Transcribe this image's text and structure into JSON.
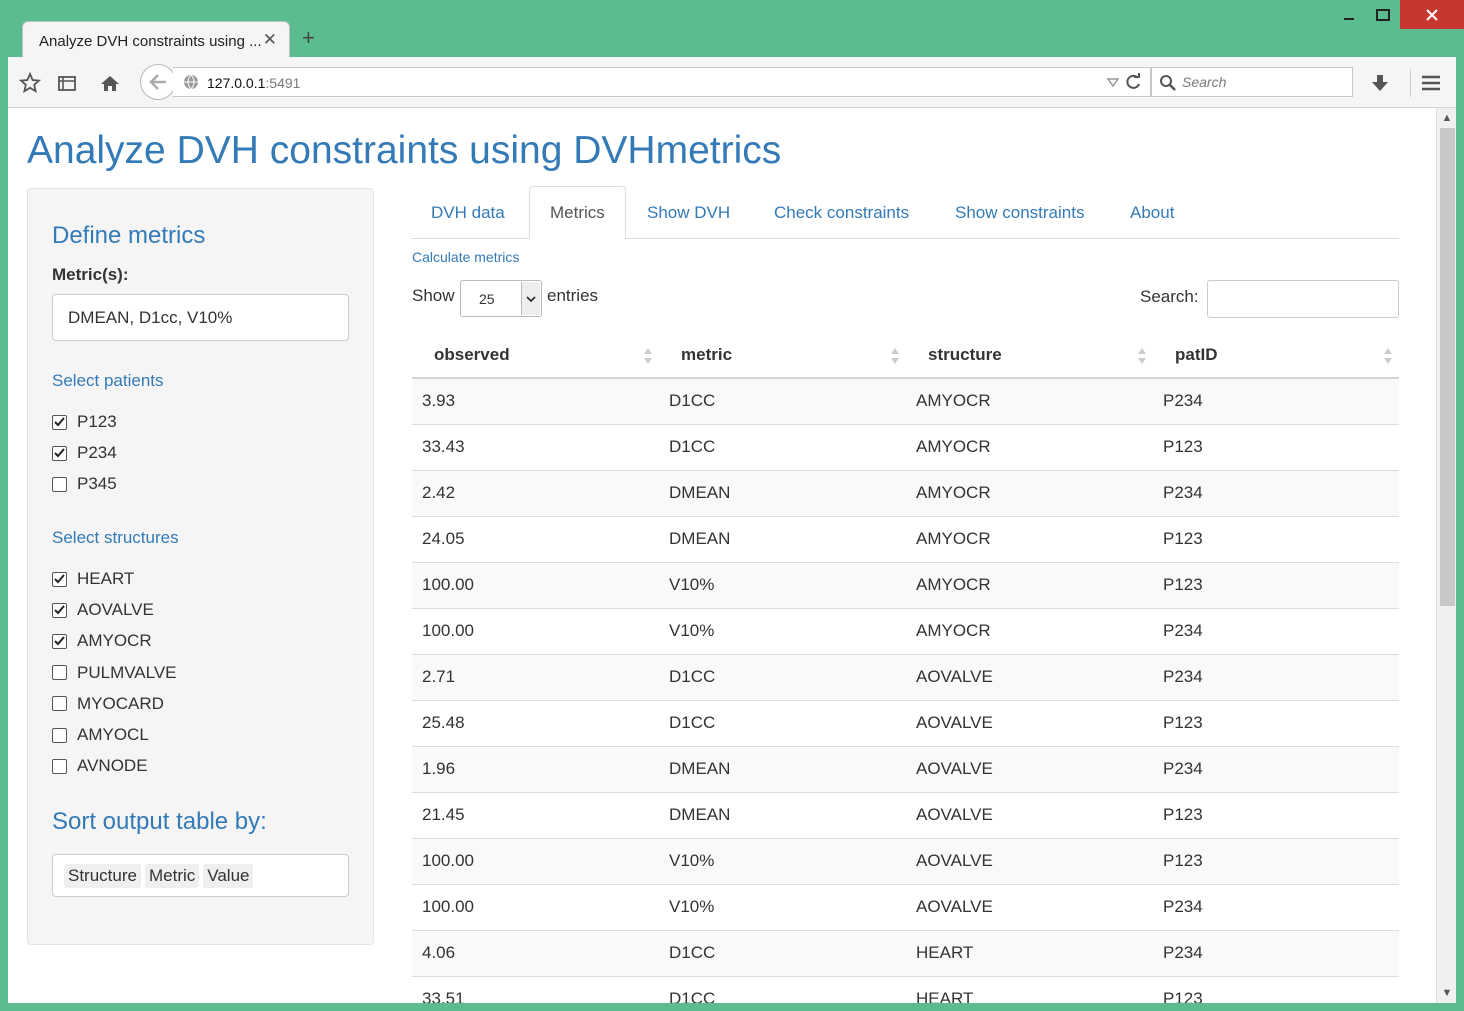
{
  "browser": {
    "tab_title": "Analyze DVH constraints using ...",
    "new_tab": "+",
    "url_host": "127.0.0.1",
    "url_port": ":5491",
    "search_placeholder": "Search"
  },
  "page": {
    "title": "Analyze DVH constraints using DVHmetrics"
  },
  "sidebar": {
    "define_heading": "Define metrics",
    "metrics_label": "Metric(s):",
    "metrics_value": "DMEAN, D1cc, V10%",
    "patients_heading": "Select patients",
    "patients": [
      {
        "label": "P123",
        "checked": true
      },
      {
        "label": "P234",
        "checked": true
      },
      {
        "label": "P345",
        "checked": false
      }
    ],
    "structures_heading": "Select structures",
    "structures": [
      {
        "label": "HEART",
        "checked": true
      },
      {
        "label": "AOVALVE",
        "checked": true
      },
      {
        "label": "AMYOCR",
        "checked": true
      },
      {
        "label": "PULMVALVE",
        "checked": false
      },
      {
        "label": "MYOCARD",
        "checked": false
      },
      {
        "label": "AMYOCL",
        "checked": false
      },
      {
        "label": "AVNODE",
        "checked": false
      }
    ],
    "sort_heading": "Sort output table by:",
    "sort_items": [
      "Structure",
      "Metric",
      "Value"
    ]
  },
  "tabs": [
    "DVH data",
    "Metrics",
    "Show DVH",
    "Check constraints",
    "Show constraints",
    "About"
  ],
  "active_tab": "Metrics",
  "subtab": "Calculate metrics",
  "table_controls": {
    "show_label": "Show",
    "entries_value": "25",
    "entries_label": "entries",
    "search_label": "Search:"
  },
  "table": {
    "columns": [
      "observed",
      "metric",
      "structure",
      "patID"
    ],
    "rows": [
      [
        "3.93",
        "D1CC",
        "AMYOCR",
        "P234"
      ],
      [
        "33.43",
        "D1CC",
        "AMYOCR",
        "P123"
      ],
      [
        "2.42",
        "DMEAN",
        "AMYOCR",
        "P234"
      ],
      [
        "24.05",
        "DMEAN",
        "AMYOCR",
        "P123"
      ],
      [
        "100.00",
        "V10%",
        "AMYOCR",
        "P123"
      ],
      [
        "100.00",
        "V10%",
        "AMYOCR",
        "P234"
      ],
      [
        "2.71",
        "D1CC",
        "AOVALVE",
        "P234"
      ],
      [
        "25.48",
        "D1CC",
        "AOVALVE",
        "P123"
      ],
      [
        "1.96",
        "DMEAN",
        "AOVALVE",
        "P234"
      ],
      [
        "21.45",
        "DMEAN",
        "AOVALVE",
        "P123"
      ],
      [
        "100.00",
        "V10%",
        "AOVALVE",
        "P123"
      ],
      [
        "100.00",
        "V10%",
        "AOVALVE",
        "P234"
      ],
      [
        "4.06",
        "D1CC",
        "HEART",
        "P234"
      ],
      [
        "33.51",
        "D1CC",
        "HEART",
        "P123"
      ]
    ]
  },
  "colors": {
    "window_frame": "#5bbd8f",
    "accent": "#337ab7",
    "close_button": "#c7372f"
  }
}
